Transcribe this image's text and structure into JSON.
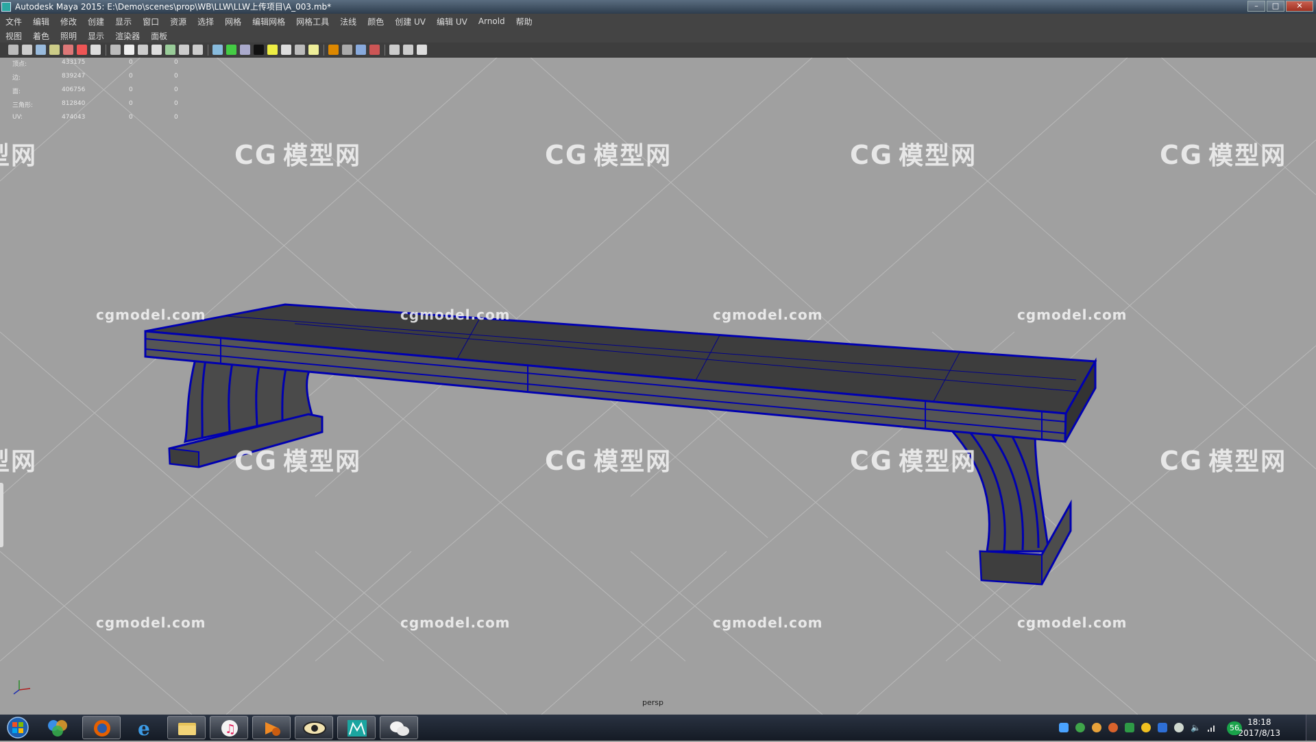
{
  "window": {
    "title": "Autodesk Maya 2015: E:\\Demo\\scenes\\prop\\WB\\LLW\\LLW上传项目\\A_003.mb*",
    "buttons": [
      "–",
      "□",
      "✕"
    ]
  },
  "main_menu": [
    "文件",
    "编辑",
    "修改",
    "创建",
    "显示",
    "窗口",
    "资源",
    "选择",
    "网格",
    "编辑网格",
    "网格工具",
    "法线",
    "颜色",
    "创建 UV",
    "编辑 UV",
    "Arnold",
    "帮助"
  ],
  "panel_menu": [
    "视图",
    "着色",
    "照明",
    "显示",
    "渲染器",
    "面板"
  ],
  "toolbar_icons": [
    "camera-attr-icon",
    "camera-lock-icon",
    "bookmark-icon",
    "image-plane-icon",
    "2d-pan-icon",
    "grease-pencil-icon",
    "grid-icon",
    "film-gate-icon",
    "resolution-gate-icon",
    "gate-mask-icon",
    "field-chart-icon",
    "safe-action-icon",
    "safe-title-icon",
    "wireframe-icon",
    "smooth-shade-icon",
    "wireframe-on-shaded-icon",
    "default-material-icon",
    "texture-icon",
    "use-all-lights-icon",
    "shadows-icon",
    "screen-space-ao-icon",
    "motion-blur-icon",
    "multisample-aa-icon",
    "depth-of-field-icon",
    "isolate-select-icon",
    "xray-icon",
    "xray-joints-icon",
    "xray-component-icon",
    "share-icon"
  ],
  "hud": {
    "rows": [
      {
        "label": "顶点:",
        "values": [
          "433175",
          "0",
          "0"
        ]
      },
      {
        "label": "边:",
        "values": [
          "839247",
          "0",
          "0"
        ]
      },
      {
        "label": "面:",
        "values": [
          "406756",
          "0",
          "0"
        ]
      },
      {
        "label": "三角形:",
        "values": [
          "812840",
          "0",
          "0"
        ]
      },
      {
        "label": "UV:",
        "values": [
          "474043",
          "0",
          "0"
        ]
      }
    ]
  },
  "viewport": {
    "camera_label": "persp",
    "background_color": "#a0a0a0",
    "wire_color": "#0000b0",
    "mesh_color": "#4a4a4a"
  },
  "watermarks": {
    "site_text": "cgmodel.com",
    "logo_text": "模型网",
    "logo_mark": "CG"
  },
  "taskbar": {
    "apps": [
      "start-orb-icon",
      "photoshop-icon",
      "firefox-icon",
      "internet-explorer-icon",
      "file-explorer-icon",
      "itunes-icon",
      "media-player-icon",
      "eye-viewer-icon",
      "maya-icon",
      "wechat-icon"
    ],
    "tray_badge": "56",
    "time": "18:18",
    "date": "2017/8/13"
  }
}
